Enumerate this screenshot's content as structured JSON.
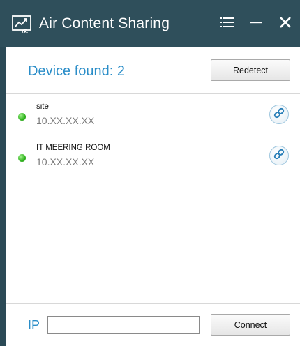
{
  "window": {
    "title": "Air Content Sharing",
    "title_bar_color": "#2f4f5b",
    "accent_color": "#2a8dc8"
  },
  "header": {
    "device_found": "Device found: 2",
    "redetect_label": "Redetect"
  },
  "devices": [
    {
      "name": "site",
      "ip": "10.XX.XX.XX",
      "status": "online",
      "status_color": "#2fb31d",
      "action_icon": "link-icon"
    },
    {
      "name": "IT MEERING ROOM",
      "ip": "10.XX.XX.XX",
      "status": "online",
      "status_color": "#2fb31d",
      "action_icon": "link-icon"
    }
  ],
  "footer": {
    "ip_label": "IP",
    "ip_value": "",
    "connect_label": "Connect"
  },
  "icons": {
    "app": "screen-share-icon",
    "menu": "menu-icon",
    "minimize": "minimize-icon",
    "close": "close-icon"
  }
}
